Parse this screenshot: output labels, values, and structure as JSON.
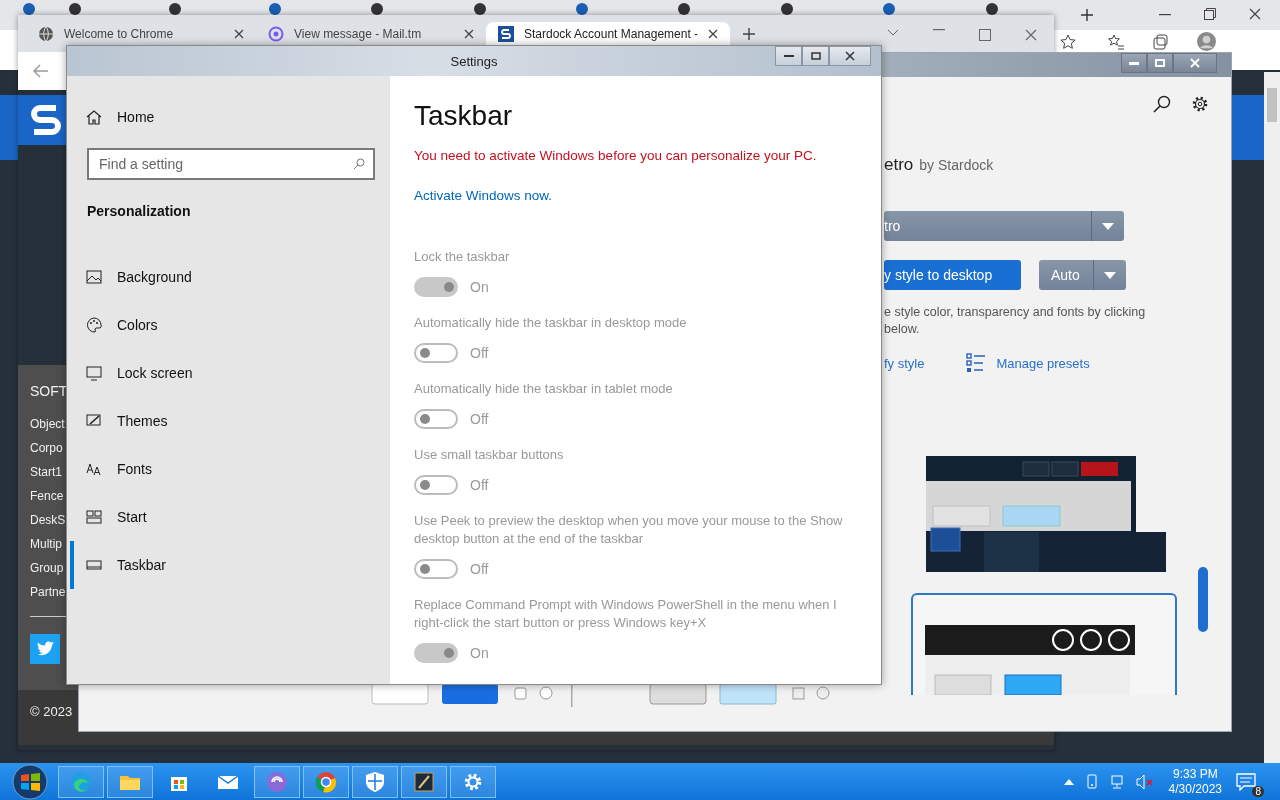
{
  "browser": {
    "tabs": [
      {
        "title": "Welcome to Chrome",
        "selected": false
      },
      {
        "title": "View message - Mail.tm",
        "selected": false
      },
      {
        "title": "Stardock Account Management -",
        "selected": true
      }
    ]
  },
  "web_page": {
    "footer_heading": "SOFT",
    "footer_links": [
      "Object",
      "Corpo",
      "Start1",
      "Fence",
      "DeskS",
      "Multip",
      "Group",
      "Partne"
    ],
    "copyright": "© 2023"
  },
  "stardock": {
    "app_name": "etro",
    "byline": "by Stardock",
    "style_dropdown": "tro",
    "apply_button": "y style to desktop",
    "mode_dropdown": "Auto",
    "hint_lines": [
      "e style color, transparency and fonts by clicking",
      "below."
    ],
    "modify_link": "fy style",
    "presets_link": "Manage presets"
  },
  "settings": {
    "title": "Settings",
    "home": "Home",
    "search": {
      "placeholder": "Find a setting"
    },
    "section": "Personalization",
    "nav": [
      {
        "label": "Background",
        "selected": false
      },
      {
        "label": "Colors",
        "selected": false
      },
      {
        "label": "Lock screen",
        "selected": false
      },
      {
        "label": "Themes",
        "selected": false
      },
      {
        "label": "Fonts",
        "selected": false
      },
      {
        "label": "Start",
        "selected": false
      },
      {
        "label": "Taskbar",
        "selected": true
      }
    ],
    "heading": "Taskbar",
    "warning": "You need to activate Windows before you can personalize your PC.",
    "activate_link": "Activate Windows now.",
    "toggles": [
      {
        "label": "Lock the taskbar",
        "on": true,
        "state": "On",
        "disabled": true
      },
      {
        "label": "Automatically hide the taskbar in desktop mode",
        "on": false,
        "state": "Off",
        "disabled": true
      },
      {
        "label": "Automatically hide the taskbar in tablet mode",
        "on": false,
        "state": "Off",
        "disabled": true
      },
      {
        "label": "Use small taskbar buttons",
        "on": false,
        "state": "Off",
        "disabled": true
      },
      {
        "label": "Use Peek to preview the desktop when you move your mouse to the Show desktop button at the end of the taskbar",
        "on": false,
        "state": "Off",
        "disabled": true
      },
      {
        "label": "Replace Command Prompt with Windows PowerShell in the menu when I right-click the start button or press Windows key+X",
        "on": true,
        "state": "On",
        "disabled": true
      }
    ]
  },
  "taskbar": {
    "apps": [
      {
        "running": true
      },
      {
        "running": true
      },
      {
        "running": false
      },
      {
        "running": false
      },
      {
        "running": true
      },
      {
        "running": true
      },
      {
        "running": true
      },
      {
        "running": true
      },
      {
        "running": true
      }
    ],
    "time": "9:33 PM",
    "date": "4/30/2023",
    "notification_count": "8"
  }
}
